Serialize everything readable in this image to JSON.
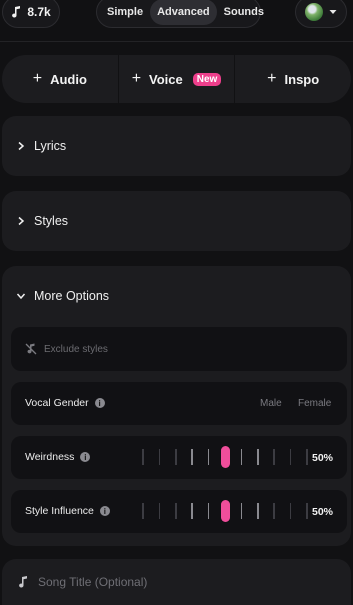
{
  "topbar": {
    "credits_value": "8.7k",
    "credits_icon": "music-note-icon",
    "mode_tabs": [
      "Simple",
      "Advanced",
      "Sounds"
    ],
    "active_mode": "Advanced"
  },
  "add_row": {
    "buttons": [
      "Audio",
      "Voice",
      "Inspo"
    ],
    "voice_badge": "New"
  },
  "sections": {
    "lyrics": "Lyrics",
    "styles": "Styles",
    "more_options": "More Options"
  },
  "more_options": {
    "exclude_placeholder": "Exclude styles",
    "vocal_gender": {
      "label": "Vocal Gender",
      "options": [
        "Male",
        "Female"
      ]
    },
    "weirdness": {
      "label": "Weirdness",
      "value": "50%",
      "fraction": 0.5
    },
    "style_influence": {
      "label": "Style Influence",
      "value": "50%",
      "fraction": 0.5
    }
  },
  "song_title": {
    "placeholder": "Song Title (Optional)"
  },
  "colors": {
    "accent": "#ee3f8c",
    "panel": "#1c1c1f",
    "background": "#111113"
  }
}
